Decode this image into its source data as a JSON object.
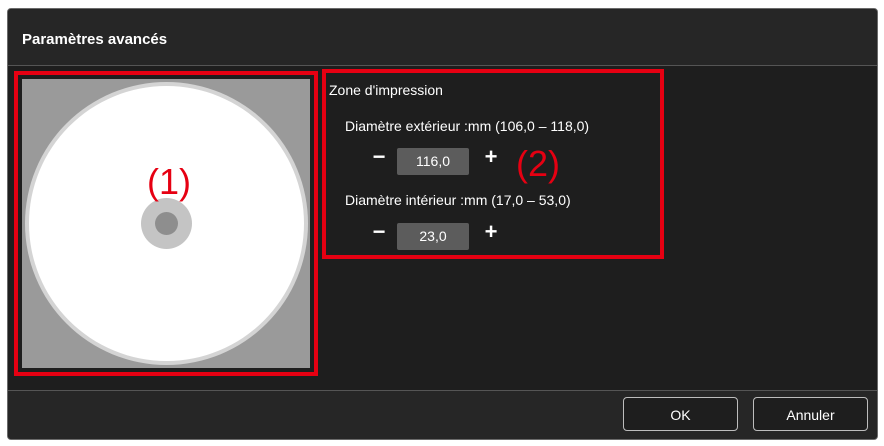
{
  "dialog": {
    "title": "Paramètres avancés"
  },
  "preview": {
    "marker": "(1)"
  },
  "print_zone": {
    "title": "Zone d'impression",
    "marker": "(2)",
    "outer_diameter": {
      "label": "Diamètre extérieur :mm (106,0 – 118,0)",
      "value": "116,0",
      "decrement": "−",
      "increment": "+"
    },
    "inner_diameter": {
      "label": "Diamètre intérieur :mm (17,0 – 53,0)",
      "value": "23,0",
      "decrement": "−",
      "increment": "+"
    }
  },
  "footer": {
    "ok_label": "OK",
    "cancel_label": "Annuler"
  },
  "colors": {
    "highlight": "#e60012",
    "background": "#1c1c1c",
    "value_box": "#5c5c5c"
  }
}
